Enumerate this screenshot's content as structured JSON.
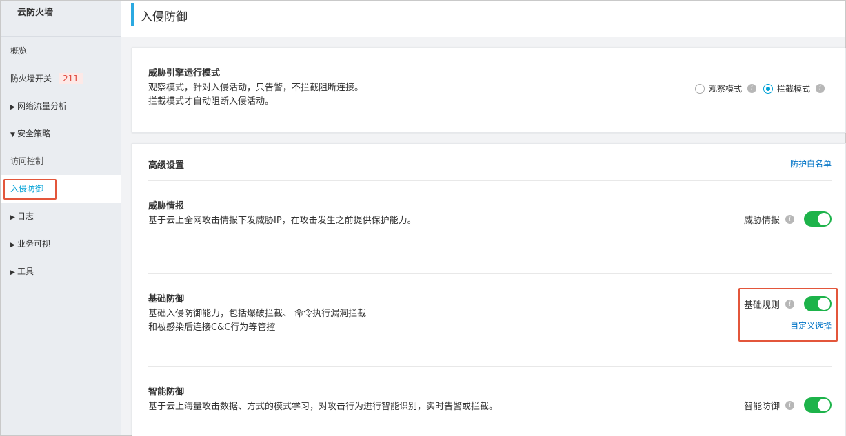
{
  "sidebar": {
    "title": "云防火墙",
    "items": [
      {
        "label": "概览"
      },
      {
        "label": "防火墙开关",
        "badge": "211"
      },
      {
        "label": "网络流量分析",
        "arrow": "▶"
      },
      {
        "label": "安全策略",
        "arrow": "▼"
      },
      {
        "label": "访问控制"
      },
      {
        "label": "入侵防御"
      },
      {
        "label": "日志",
        "arrow": "▶"
      },
      {
        "label": "业务可视",
        "arrow": "▶"
      },
      {
        "label": "工具",
        "arrow": "▶"
      }
    ]
  },
  "header": {
    "title": "入侵防御"
  },
  "engine": {
    "title": "威胁引擎运行模式",
    "desc1": "观察模式，针对入侵活动，只告警，不拦截阻断连接。",
    "desc2": "拦截模式才自动阻断入侵活动。",
    "options": [
      {
        "label": "观察模式",
        "checked": false
      },
      {
        "label": "拦截模式",
        "checked": true
      }
    ]
  },
  "advanced": {
    "title": "高级设置",
    "whitelist_link": "防护白名单",
    "threat_intel": {
      "title": "威胁情报",
      "desc": "基于云上全网攻击情报下发威胁IP，在攻击发生之前提供保护能力。",
      "toggle_label": "威胁情报",
      "enabled": true
    },
    "basic": {
      "title": "基础防御",
      "desc1": "基础入侵防御能力，包括爆破拦截、 命令执行漏洞拦截",
      "desc2": "和被感染后连接C&C行为等管控",
      "toggle_label": "基础规则",
      "enabled": true,
      "custom_link": "自定义选择"
    },
    "smart": {
      "title": "智能防御",
      "desc": "基于云上海量攻击数据、方式的模式学习，对攻击行为进行智能识别，实时告警或拦截。",
      "toggle_label": "智能防御",
      "enabled": true
    }
  },
  "colors": {
    "accent": "#00a1d6",
    "toggle_on": "#1db34a",
    "highlight": "#e3563b",
    "link": "#0073c6"
  },
  "icons": {
    "info": "i"
  }
}
